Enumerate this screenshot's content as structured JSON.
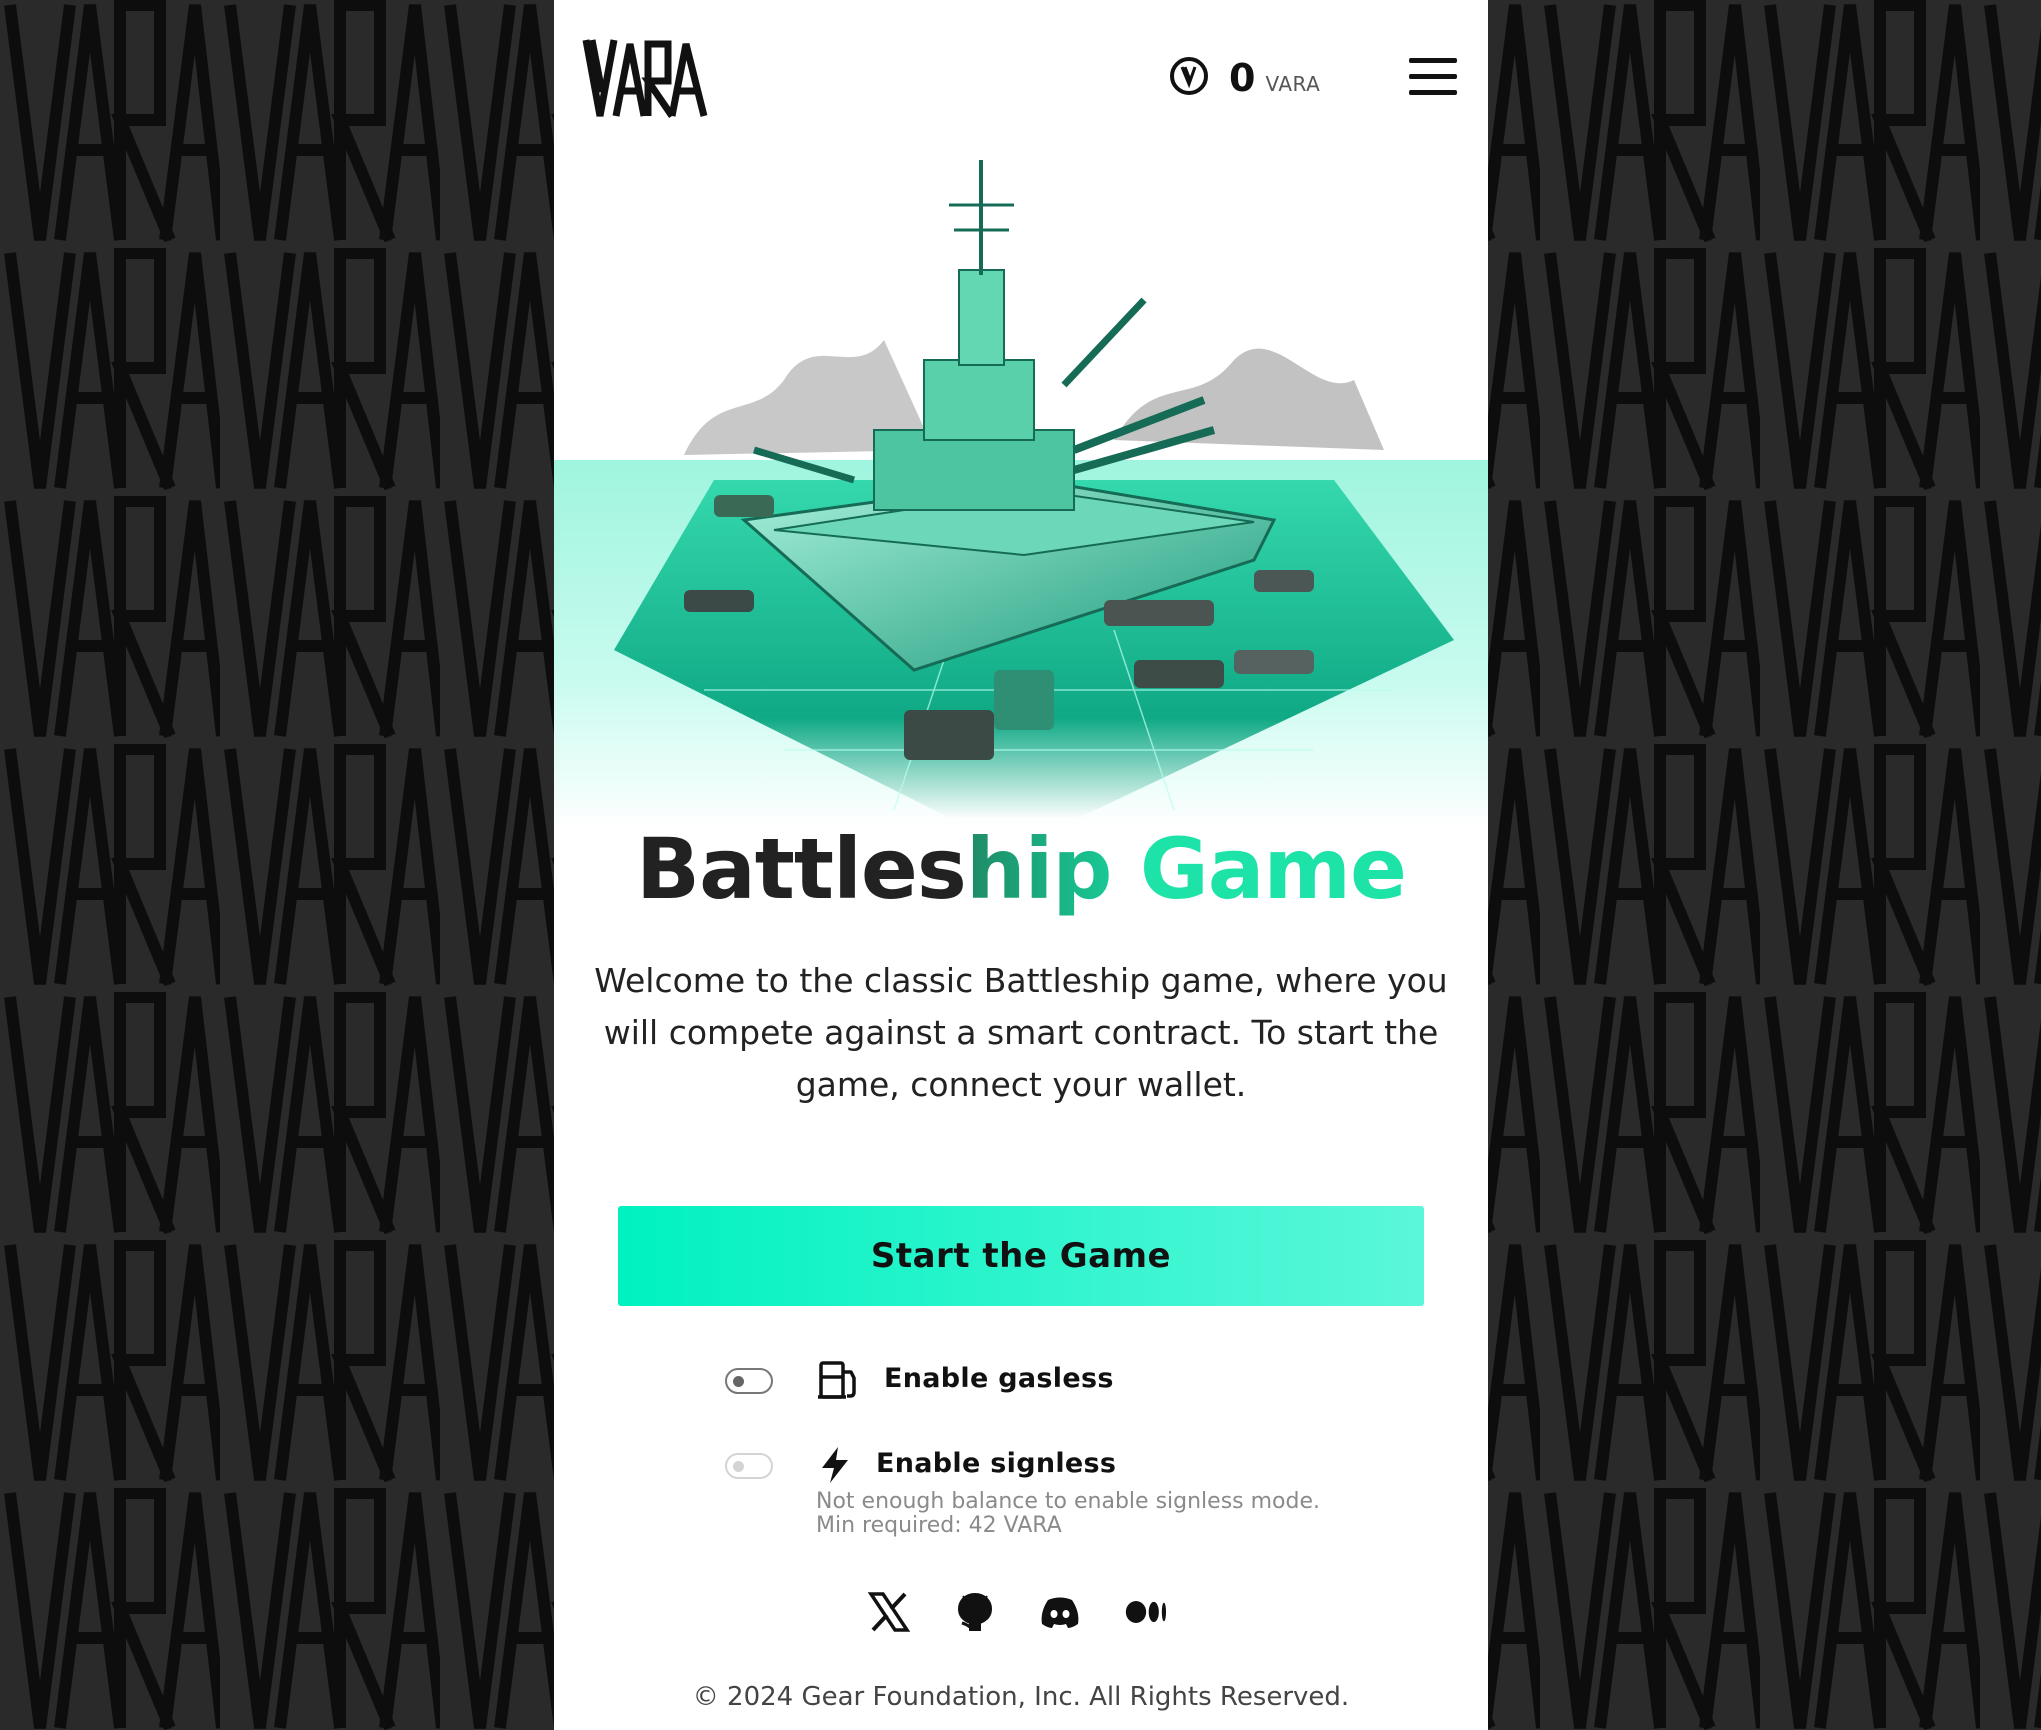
{
  "header": {
    "logo_text": "VARA",
    "balance_value": "0",
    "balance_unit": "VARA",
    "menu_icon": "hamburger-menu-icon",
    "balance_icon": "vara-coin-icon"
  },
  "hero": {
    "image": "battleship-illustration"
  },
  "title": {
    "part1": "Battles",
    "part2": "hip",
    "part3": "Game"
  },
  "description": "Welcome to the classic Battleship game, where you will compete against a smart contract. To start the game, connect your wallet.",
  "start_button": "Start the Game",
  "options": {
    "gasless": {
      "label": "Enable gasless",
      "icon": "gas-pump-icon",
      "enabled": false
    },
    "signless": {
      "label": "Enable signless",
      "icon": "lightning-icon",
      "enabled": false,
      "disabled": true,
      "hint_line1": "Not enough balance to enable signless mode.",
      "hint_line2": "Min required: 42 VARA"
    }
  },
  "socials": [
    "x-icon",
    "github-icon",
    "discord-icon",
    "medium-icon"
  ],
  "footer": "© 2024 Gear Foundation, Inc. All Rights Reserved.",
  "colors": {
    "accent": "#1ee3a8",
    "button_start": "#00f2c0",
    "button_end": "#5bf7da",
    "background": "#2a2a2a"
  }
}
